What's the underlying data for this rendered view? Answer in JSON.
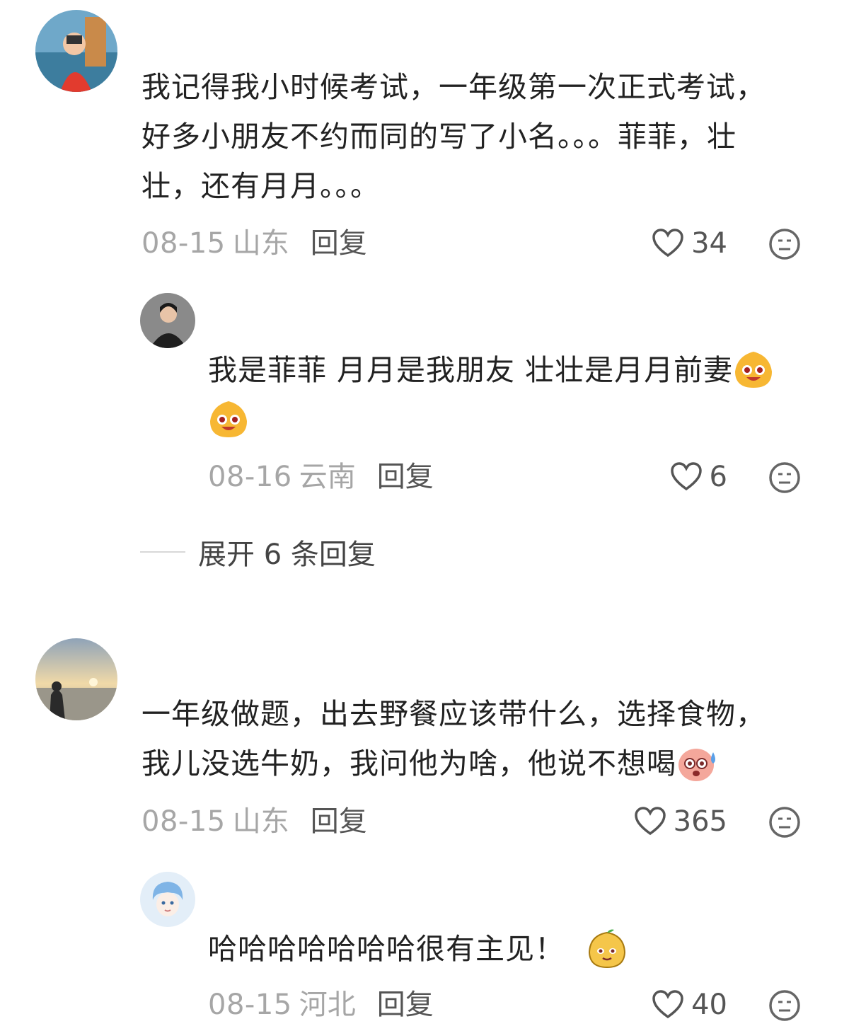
{
  "comments": [
    {
      "avatar": "woman-at-sea-avatar",
      "lines": [
        "我记得我小时候考试，一年级第一次正式考试，",
        "好多小朋友不约而同的写了小名。。。菲菲，壮",
        "壮，还有月月。。。"
      ],
      "date": "08-15",
      "location": "山东",
      "reply_label": "回复",
      "likes": "34",
      "replies": [
        {
          "avatar": "woman-portrait-avatar",
          "lines": [
            "我是菲菲 月月是我朋友 壮壮是月月前妻",
            ""
          ],
          "emoji": "laughing-face-icon",
          "date": "08-16",
          "location": "云南",
          "reply_label": "回复",
          "likes": "6"
        }
      ],
      "expand_label": "展开 6 条回复"
    },
    {
      "avatar": "sunset-beach-avatar",
      "lines": [
        "一年级做题，出去野餐应该带什么，选择食物，",
        "我儿没选牛奶，我问他为啥，他说不想喝"
      ],
      "emoji": "sweat-face-icon",
      "date": "08-15",
      "location": "山东",
      "reply_label": "回复",
      "likes": "365",
      "replies": [
        {
          "avatar": "anime-avatar",
          "lines": [
            "哈哈哈哈哈哈哈很有主见！"
          ],
          "emoji": "smirk-face-icon",
          "date": "08-15",
          "location": "河北",
          "reply_label": "回复",
          "likes": "40"
        }
      ]
    }
  ],
  "colors": {
    "meta": "#a6a6a6",
    "text": "#222222",
    "action": "#555555"
  }
}
